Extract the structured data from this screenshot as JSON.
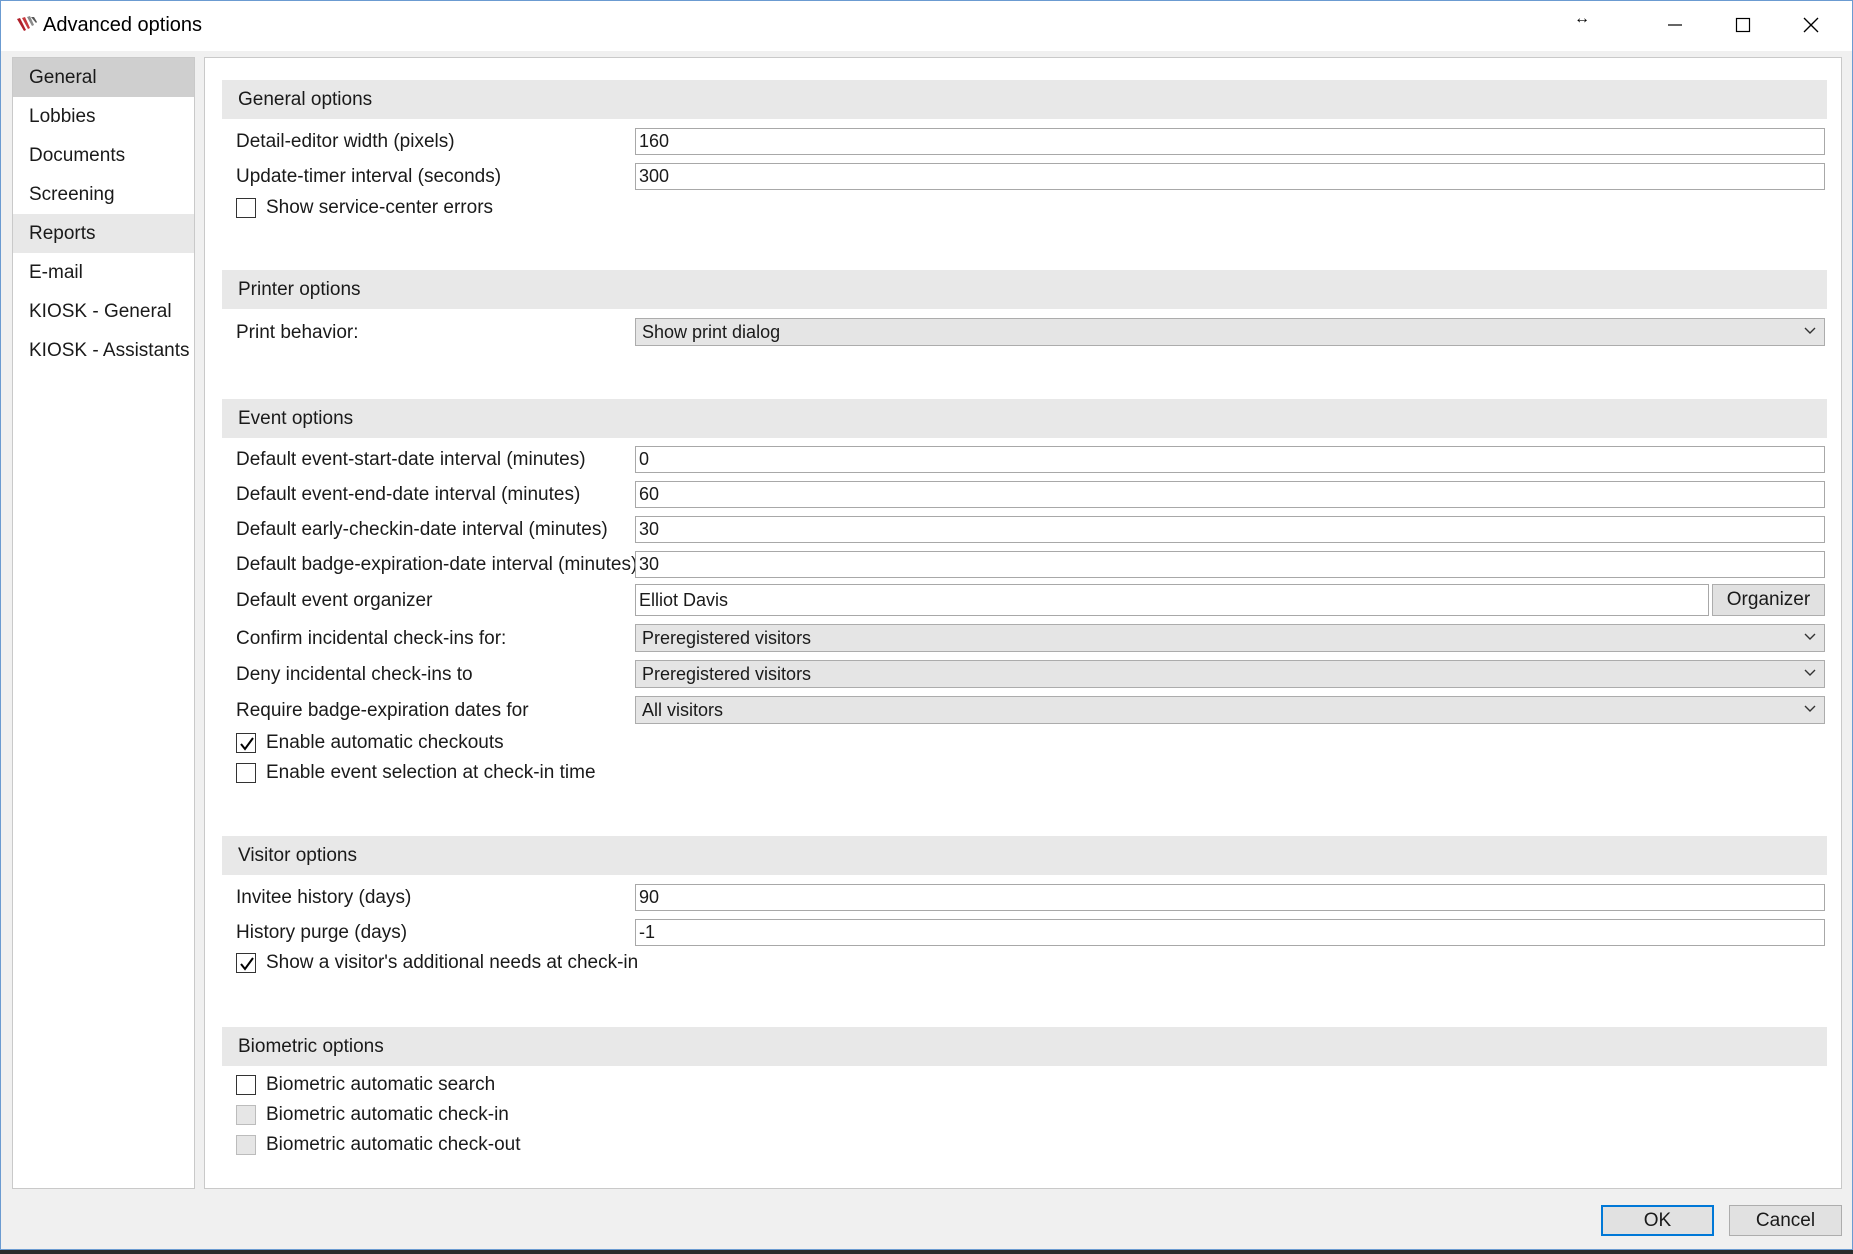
{
  "window": {
    "title": "Advanced options",
    "resize_glyph": "↔"
  },
  "sidebar": {
    "items": [
      {
        "label": "General"
      },
      {
        "label": "Lobbies"
      },
      {
        "label": "Documents"
      },
      {
        "label": "Screening"
      },
      {
        "label": "Reports"
      },
      {
        "label": "E-mail"
      },
      {
        "label": "KIOSK - General"
      },
      {
        "label": "KIOSK - Assistants"
      }
    ],
    "selected": "General",
    "hovered": "Reports"
  },
  "general": {
    "header": "General options",
    "detail_editor_label": "Detail-editor width (pixels)",
    "detail_editor_value": "160",
    "update_timer_label": "Update-timer interval (seconds)",
    "update_timer_value": "300",
    "show_errors_label": "Show service-center errors",
    "show_errors_checked": false
  },
  "printer": {
    "header": "Printer options",
    "print_behavior_label": "Print behavior:",
    "print_behavior_value": "Show print dialog"
  },
  "event": {
    "header": "Event options",
    "start_label": "Default event-start-date interval (minutes)",
    "start_value": "0",
    "end_label": "Default event-end-date interval (minutes)",
    "end_value": "60",
    "early_label": "Default early-checkin-date interval (minutes)",
    "early_value": "30",
    "badge_label": "Default badge-expiration-date interval (minutes)",
    "badge_value": "30",
    "organizer_label": "Default event organizer",
    "organizer_value": "Elliot Davis",
    "organizer_button": "Organizer",
    "confirm_label": "Confirm incidental check-ins for:",
    "confirm_value": "Preregistered visitors",
    "deny_label": "Deny incidental check-ins to",
    "deny_value": "Preregistered visitors",
    "require_label": "Require badge-expiration dates for",
    "require_value": "All visitors",
    "auto_checkout_label": "Enable automatic checkouts",
    "auto_checkout_checked": true,
    "event_selection_label": "Enable event selection at check-in time",
    "event_selection_checked": false
  },
  "visitor": {
    "header": "Visitor options",
    "invitee_label": "Invitee history (days)",
    "invitee_value": "90",
    "purge_label": "History purge (days)",
    "purge_value": "-1",
    "needs_label": "Show a visitor's additional needs at check-in",
    "needs_checked": true
  },
  "biometric": {
    "header": "Biometric options",
    "search_label": "Biometric automatic search",
    "search_checked": false,
    "checkin_label": "Biometric automatic check-in",
    "checkin_enabled": false,
    "checkout_label": "Biometric automatic check-out",
    "checkout_enabled": false
  },
  "footer": {
    "ok_label": "OK",
    "cancel_label": "Cancel"
  },
  "colors": {
    "window_border": "#6b9bd1",
    "selected_nav": "#cfcfcf",
    "section_header": "#e8e8e8",
    "default_button_border": "#0078d7"
  },
  "icons": {
    "app": "app-logo-icon",
    "minimize": "minimize-icon",
    "maximize": "maximize-icon",
    "close": "close-icon",
    "dropdown": "chevron-down-icon",
    "check": "checkmark-icon"
  }
}
